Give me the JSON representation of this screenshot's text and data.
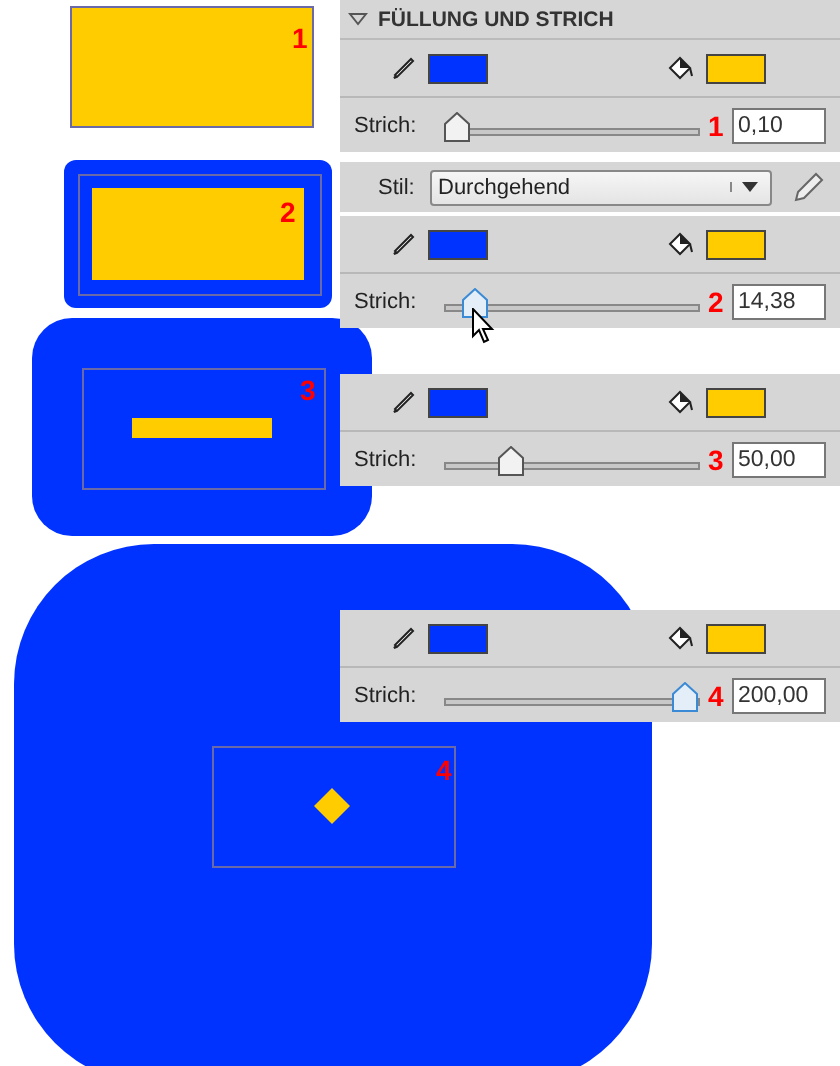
{
  "section": {
    "title": "FÜLLUNG UND STRICH",
    "expanded": true
  },
  "shapes": [
    {
      "kind": "hairline",
      "label": "1"
    },
    {
      "kind": "thin",
      "label": "2"
    },
    {
      "kind": "medium",
      "label": "3"
    },
    {
      "kind": "thick",
      "label": "4"
    }
  ],
  "panels": [
    {
      "stroke_label": "Strich:",
      "level": 0.0,
      "marker": "1",
      "value": "0,10",
      "hovered": false,
      "style": {
        "label": "Stil:",
        "value": "Durchgehend"
      }
    },
    {
      "stroke_label": "Strich:",
      "level": 0.08,
      "marker": "2",
      "value": "14,38",
      "hovered": true,
      "cursor": true
    },
    {
      "stroke_label": "Strich:",
      "level": 0.24,
      "marker": "3",
      "value": "50,00",
      "hovered": false
    },
    {
      "stroke_label": "Strich:",
      "level": 1.0,
      "marker": "4",
      "value": "200,00",
      "hovered": true
    }
  ]
}
